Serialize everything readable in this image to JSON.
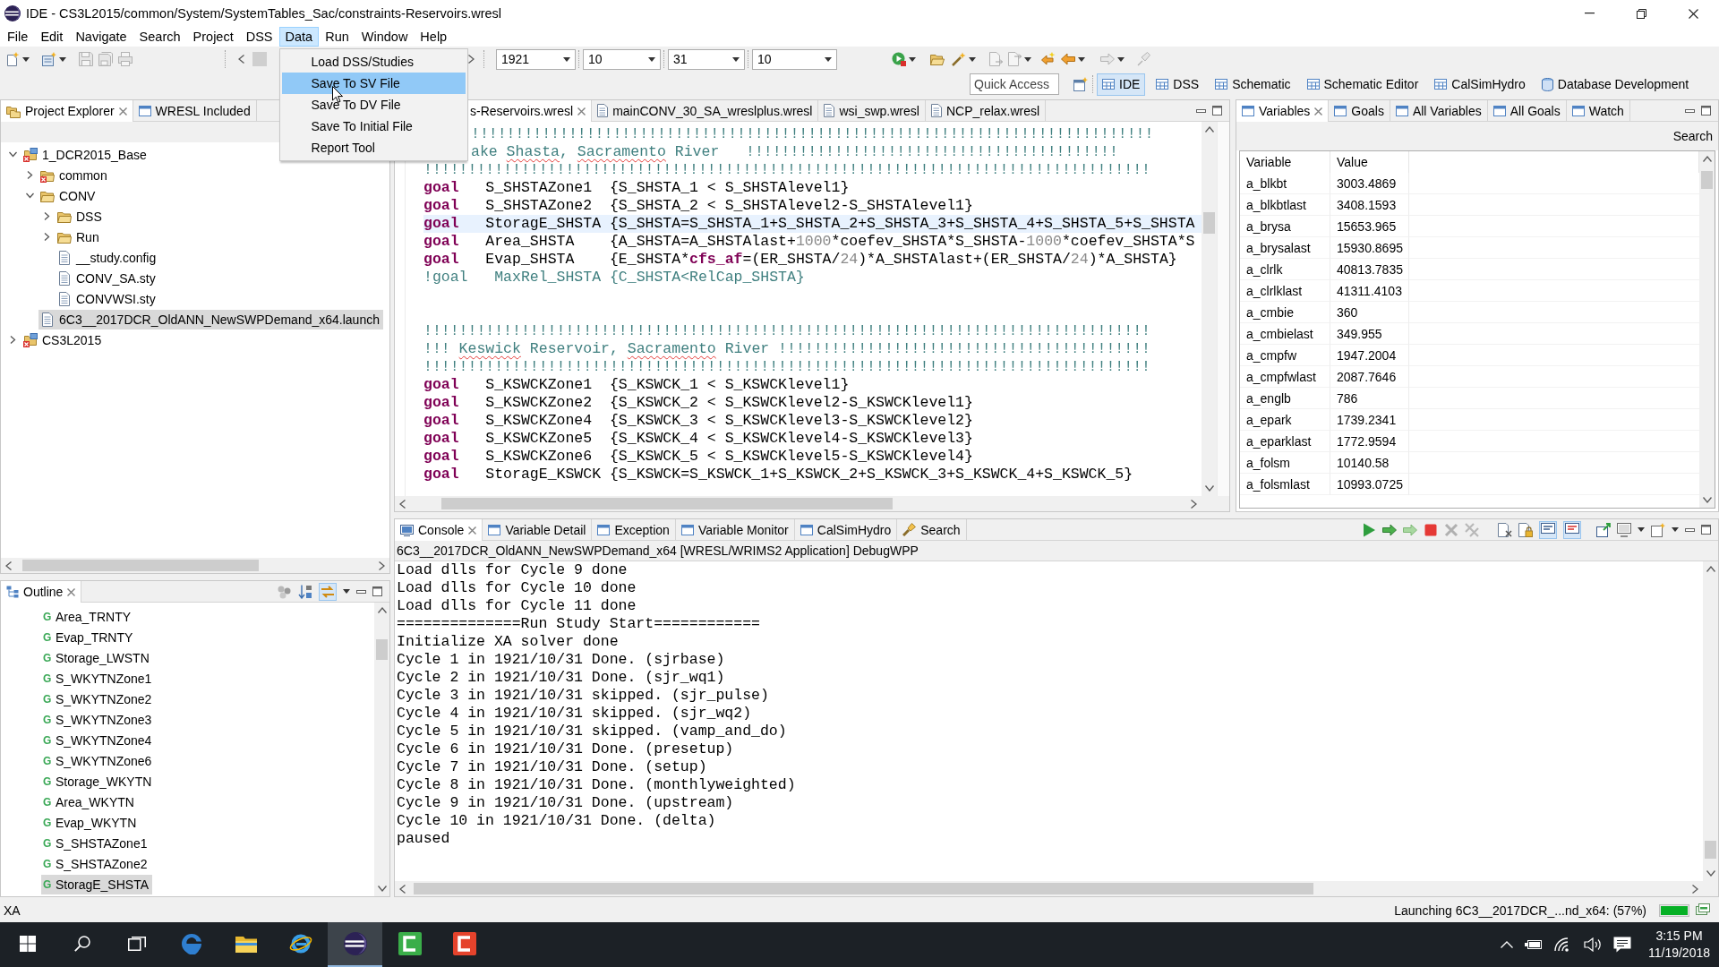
{
  "window": {
    "title": "IDE - CS3L2015/common/System/SystemTables_Sac/constraints-Reservoirs.wresl"
  },
  "menu_bar": [
    {
      "label": "File",
      "selected": false
    },
    {
      "label": "Edit",
      "selected": false
    },
    {
      "label": "Navigate",
      "selected": false
    },
    {
      "label": "Search",
      "selected": false
    },
    {
      "label": "Project",
      "selected": false
    },
    {
      "label": "DSS",
      "selected": false
    },
    {
      "label": "Data",
      "selected": true,
      "items": [
        {
          "label": "Load DSS/Studies",
          "selected": false
        },
        {
          "label": "Save To SV File",
          "selected": true
        },
        {
          "label": "Save To DV File",
          "selected": false
        },
        {
          "label": "Save To Initial File",
          "selected": false
        },
        {
          "label": "Report Tool",
          "selected": false
        }
      ]
    },
    {
      "label": "Run",
      "selected": false
    },
    {
      "label": "Window",
      "selected": false
    },
    {
      "label": "Help",
      "selected": false
    }
  ],
  "toolbar": {
    "combos": [
      {
        "value": "1921"
      },
      {
        "value": "10"
      },
      {
        "value": "31"
      },
      {
        "value": "10"
      }
    ],
    "quick_access": {
      "placeholder": "Quick Access"
    },
    "perspectives": [
      {
        "label": "IDE",
        "selected": true
      },
      {
        "label": "DSS",
        "selected": false
      },
      {
        "label": "Schematic",
        "selected": false
      },
      {
        "label": "Schematic Editor",
        "selected": false
      },
      {
        "label": "CalSimHydro",
        "selected": false
      },
      {
        "label": "Database Development",
        "selected": false
      }
    ]
  },
  "project_explorer": {
    "tabs": [
      {
        "label": "Project Explorer",
        "selected": true
      },
      {
        "label": "WRESL Included",
        "selected": false
      }
    ],
    "tree": [
      {
        "label": "1_DCR2015_Base",
        "kind": "project",
        "error": true,
        "expanded": true,
        "selected": false,
        "children": [
          {
            "label": "common",
            "kind": "folder",
            "error": true,
            "expanded": false,
            "selected": false
          },
          {
            "label": "CONV",
            "kind": "folder",
            "error": false,
            "expanded": true,
            "selected": false,
            "children": [
              {
                "label": "DSS",
                "kind": "folder",
                "error": false,
                "expanded": false,
                "selected": false
              },
              {
                "label": "Run",
                "kind": "folder",
                "error": false,
                "expanded": false,
                "selected": false
              },
              {
                "label": "__study.config",
                "kind": "file",
                "error": false,
                "selected": false
              },
              {
                "label": "CONV_SA.sty",
                "kind": "file",
                "error": false,
                "selected": false
              },
              {
                "label": "CONVWSI.sty",
                "kind": "file",
                "error": false,
                "selected": false
              }
            ]
          },
          {
            "label": "6C3__2017DCR_OldANN_NewSWPDemand_x64.launch",
            "kind": "file",
            "error": false,
            "selected": true
          }
        ]
      },
      {
        "label": "CS3L2015",
        "kind": "project",
        "error": true,
        "expanded": false,
        "selected": false
      }
    ]
  },
  "outline": {
    "tabs": [
      {
        "label": "Outline",
        "selected": true
      }
    ],
    "toolbar_toggle": {
      "on": true
    },
    "items": [
      {
        "type_letter": "G",
        "label": "Area_TRNTY",
        "selected": false
      },
      {
        "type_letter": "G",
        "label": "Evap_TRNTY",
        "selected": false
      },
      {
        "type_letter": "G",
        "label": "Storage_LWSTN",
        "selected": false
      },
      {
        "type_letter": "G",
        "label": "S_WKYTNZone1",
        "selected": false
      },
      {
        "type_letter": "G",
        "label": "S_WKYTNZone2",
        "selected": false
      },
      {
        "type_letter": "G",
        "label": "S_WKYTNZone3",
        "selected": false
      },
      {
        "type_letter": "G",
        "label": "S_WKYTNZone4",
        "selected": false
      },
      {
        "type_letter": "G",
        "label": "S_WKYTNZone6",
        "selected": false
      },
      {
        "type_letter": "G",
        "label": "Storage_WKYTN",
        "selected": false
      },
      {
        "type_letter": "G",
        "label": "Area_WKYTN",
        "selected": false
      },
      {
        "type_letter": "G",
        "label": "Evap_WKYTN",
        "selected": false
      },
      {
        "type_letter": "G",
        "label": "S_SHSTAZone1",
        "selected": false
      },
      {
        "type_letter": "G",
        "label": "S_SHSTAZone2",
        "selected": false
      },
      {
        "type_letter": "G",
        "label": "StoragE_SHSTA",
        "selected": true
      }
    ]
  },
  "editor": {
    "tabs": [
      {
        "label": "s-Reservoirs.wresl",
        "selected": true,
        "partly_hidden": true
      },
      {
        "label": "mainCONV_30_SA_wreslplus.wresl",
        "selected": false
      },
      {
        "label": "wsi_swp.wresl",
        "selected": false
      },
      {
        "label": "NCP_relax.wresl",
        "selected": false
      }
    ],
    "lines": [
      {
        "kind": "code",
        "current": false,
        "partly_hidden": true,
        "tokens": [
          {
            "kind": "comment",
            "text": "!!!!!!!!!!!!!!!!!!!!!!!!!!!!!!!!!!!!!!!!!!!!!!!!!!!!!!!!!!!!!!!!!!!!!!!!!!!!!"
          }
        ]
      },
      {
        "kind": "code",
        "current": false,
        "partly_hidden": true,
        "tokens": [
          {
            "kind": "comment",
            "text": "ake "
          },
          {
            "kind": "misspelled",
            "text": "Shasta"
          },
          {
            "kind": "comment",
            "text": ", "
          },
          {
            "kind": "misspelled",
            "text": "Sacramento"
          },
          {
            "kind": "comment",
            "text": " River   !!!!!!!!!!!!!!!!!!!!!!!!!!!!!!!!!!!!!!!!!!"
          }
        ]
      },
      {
        "kind": "code",
        "current": false,
        "tokens": [
          {
            "kind": "comment",
            "text": "!!!!!!!!!!!!!!!!!!!!!!!!!!!!!!!!!!!!!!!!!!!!!!!!!!!!!!!!!!!!!!!!!!!!!!!!!!!!!!!!!!"
          }
        ]
      },
      {
        "kind": "code",
        "current": false,
        "tokens": [
          {
            "kind": "keyword",
            "text": "goal"
          },
          {
            "kind": "code",
            "text": "   S_SHSTAZone1  {S_SHSTA_1 < S_SHSTAlevel1}"
          }
        ]
      },
      {
        "kind": "code",
        "current": false,
        "tokens": [
          {
            "kind": "keyword",
            "text": "goal"
          },
          {
            "kind": "code",
            "text": "   S_SHSTAZone2  {S_SHSTA_2 < S_SHSTAlevel2-S_SHSTAlevel1}"
          }
        ]
      },
      {
        "kind": "code",
        "current": true,
        "tokens": [
          {
            "kind": "keyword",
            "text": "goal"
          },
          {
            "kind": "code",
            "text": "   StoragE_SHSTA {S_SHSTA=S_SHSTA_1+S_SHSTA_2+S_SHSTA_3+S_SHSTA_4+S_SHSTA_5+S_SHSTA"
          }
        ]
      },
      {
        "kind": "code",
        "current": false,
        "tokens": [
          {
            "kind": "keyword",
            "text": "goal"
          },
          {
            "kind": "code",
            "text": "   Area_SHSTA    {A_SHSTA=A_SHSTAlast+"
          },
          {
            "kind": "number",
            "text": "1000"
          },
          {
            "kind": "code",
            "text": "*coefev_SHSTA*S_SHSTA-"
          },
          {
            "kind": "number",
            "text": "1000"
          },
          {
            "kind": "code",
            "text": "*coefev_SHSTA*S"
          }
        ]
      },
      {
        "kind": "code",
        "current": false,
        "tokens": [
          {
            "kind": "keyword",
            "text": "goal"
          },
          {
            "kind": "code",
            "text": "   Evap_SHSTA    {E_SHSTA*"
          },
          {
            "kind": "keyword",
            "text": "cfs_af"
          },
          {
            "kind": "code",
            "text": "=(ER_SHSTA/"
          },
          {
            "kind": "number",
            "text": "24"
          },
          {
            "kind": "code",
            "text": ")*A_SHSTAlast+(ER_SHSTA/"
          },
          {
            "kind": "number",
            "text": "24"
          },
          {
            "kind": "code",
            "text": ")*A_SHSTA}"
          }
        ]
      },
      {
        "kind": "code",
        "current": false,
        "tokens": [
          {
            "kind": "comment",
            "text": "!goal   MaxRel_SHSTA {C_SHSTA<RelCap_SHSTA}"
          }
        ]
      },
      {
        "kind": "blank"
      },
      {
        "kind": "blank"
      },
      {
        "kind": "code",
        "current": false,
        "tokens": [
          {
            "kind": "comment",
            "text": "!!!!!!!!!!!!!!!!!!!!!!!!!!!!!!!!!!!!!!!!!!!!!!!!!!!!!!!!!!!!!!!!!!!!!!!!!!!!!!!!!!"
          }
        ]
      },
      {
        "kind": "code",
        "current": false,
        "tokens": [
          {
            "kind": "comment",
            "text": "!!! "
          },
          {
            "kind": "misspelled",
            "text": "Keswick"
          },
          {
            "kind": "comment",
            "text": " Reservoir, "
          },
          {
            "kind": "misspelled",
            "text": "Sacramento"
          },
          {
            "kind": "comment",
            "text": " River !!!!!!!!!!!!!!!!!!!!!!!!!!!!!!!!!!!!!!!!!!"
          }
        ]
      },
      {
        "kind": "code",
        "current": false,
        "tokens": [
          {
            "kind": "comment",
            "text": "!!!!!!!!!!!!!!!!!!!!!!!!!!!!!!!!!!!!!!!!!!!!!!!!!!!!!!!!!!!!!!!!!!!!!!!!!!!!!!!!!!"
          }
        ]
      },
      {
        "kind": "code",
        "current": false,
        "tokens": [
          {
            "kind": "keyword",
            "text": "goal"
          },
          {
            "kind": "code",
            "text": "   S_KSWCKZone1  {S_KSWCK_1 < S_KSWCKlevel1}"
          }
        ]
      },
      {
        "kind": "code",
        "current": false,
        "tokens": [
          {
            "kind": "keyword",
            "text": "goal"
          },
          {
            "kind": "code",
            "text": "   S_KSWCKZone2  {S_KSWCK_2 < S_KSWCKlevel2-S_KSWCKlevel1}"
          }
        ]
      },
      {
        "kind": "code",
        "current": false,
        "tokens": [
          {
            "kind": "keyword",
            "text": "goal"
          },
          {
            "kind": "code",
            "text": "   S_KSWCKZone4  {S_KSWCK_3 < S_KSWCKlevel3-S_KSWCKlevel2}"
          }
        ]
      },
      {
        "kind": "code",
        "current": false,
        "tokens": [
          {
            "kind": "keyword",
            "text": "goal"
          },
          {
            "kind": "code",
            "text": "   S_KSWCKZone5  {S_KSWCK_4 < S_KSWCKlevel4-S_KSWCKlevel3}"
          }
        ]
      },
      {
        "kind": "code",
        "current": false,
        "tokens": [
          {
            "kind": "keyword",
            "text": "goal"
          },
          {
            "kind": "code",
            "text": "   S_KSWCKZone6  {S_KSWCK_5 < S_KSWCKlevel5-S_KSWCKlevel4}"
          }
        ]
      },
      {
        "kind": "code",
        "current": false,
        "tokens": [
          {
            "kind": "keyword",
            "text": "goal"
          },
          {
            "kind": "code",
            "text": "   StoragE_KSWCK {S_KSWCK=S_KSWCK_1+S_KSWCK_2+S_KSWCK_3+S_KSWCK_4+S_KSWCK_5}"
          }
        ]
      }
    ]
  },
  "variables_view": {
    "tabs": [
      {
        "label": "Variables",
        "selected": true
      },
      {
        "label": "Goals",
        "selected": false
      },
      {
        "label": "All Variables",
        "selected": false
      },
      {
        "label": "All Goals",
        "selected": false
      },
      {
        "label": "Watch",
        "selected": false
      }
    ],
    "search": "Search",
    "columns": [
      "Variable",
      "Value"
    ],
    "rows": [
      {
        "variable": "a_blkbt",
        "value": "3003.4869"
      },
      {
        "variable": "a_blkbtlast",
        "value": "3408.1593"
      },
      {
        "variable": "a_brysa",
        "value": "15653.965"
      },
      {
        "variable": "a_brysalast",
        "value": "15930.8695"
      },
      {
        "variable": "a_clrlk",
        "value": "40813.7835"
      },
      {
        "variable": "a_clrlklast",
        "value": "41311.4103"
      },
      {
        "variable": "a_cmbie",
        "value": "360"
      },
      {
        "variable": "a_cmbielast",
        "value": "349.955"
      },
      {
        "variable": "a_cmpfw",
        "value": "1947.2004"
      },
      {
        "variable": "a_cmpfwlast",
        "value": "2087.7646"
      },
      {
        "variable": "a_englb",
        "value": "786"
      },
      {
        "variable": "a_epark",
        "value": "1739.2341"
      },
      {
        "variable": "a_eparklast",
        "value": "1772.9594"
      },
      {
        "variable": "a_folsm",
        "value": "10140.58"
      },
      {
        "variable": "a_folsmlast",
        "value": "10993.0725"
      }
    ]
  },
  "console": {
    "tabs": [
      {
        "label": "Console",
        "selected": true
      },
      {
        "label": "Variable Detail",
        "selected": false
      },
      {
        "label": "Exception",
        "selected": false
      },
      {
        "label": "Variable Monitor",
        "selected": false
      },
      {
        "label": "CalSimHydro",
        "selected": false
      },
      {
        "label": "Search",
        "selected": false
      }
    ],
    "toolbar_toggles": [
      {
        "on": true
      },
      {
        "on": true
      }
    ],
    "process": "6C3__2017DCR_OldANN_NewSWPDemand_x64 [WRESL/WRIMS2 Application] DebugWPP",
    "lines": [
      "Load dlls for Cycle 9 done",
      "Load dlls for Cycle 10 done",
      "Load dlls for Cycle 11 done",
      "==============Run Study Start============",
      "Initialize XA solver done",
      "Cycle 1 in 1921/10/31 Done. (sjrbase)",
      "Cycle 2 in 1921/10/31 Done. (sjr_wq1)",
      "Cycle 3 in 1921/10/31 skipped. (sjr_pulse)",
      "Cycle 4 in 1921/10/31 skipped. (sjr_wq2)",
      "Cycle 5 in 1921/10/31 skipped. (vamp_and_do)",
      "Cycle 6 in 1921/10/31 Done. (presetup)",
      "Cycle 7 in 1921/10/31 Done. (setup)",
      "Cycle 8 in 1921/10/31 Done. (monthlyweighted)",
      "Cycle 9 in 1921/10/31 Done. (upstream)",
      "Cycle 10 in 1921/10/31 Done. (delta)",
      "paused"
    ]
  },
  "status_bar": {
    "message": "XA",
    "progress_text": "Launching 6C3__2017DCR_...nd_x64: (57%)",
    "progress": {
      "level": 1
    }
  },
  "taskbar": {
    "buttons": [
      {
        "kind": "start",
        "active": false
      },
      {
        "kind": "search",
        "active": false
      },
      {
        "kind": "task-view",
        "active": false
      },
      {
        "kind": "edge",
        "active": false
      },
      {
        "kind": "file-explorer",
        "active": false
      },
      {
        "kind": "internet-explorer",
        "active": false
      },
      {
        "kind": "eclipse",
        "active": true
      },
      {
        "kind": "tile",
        "color": "#3aae49",
        "active": false
      },
      {
        "kind": "tile",
        "color": "#e5432c",
        "active": false
      }
    ],
    "clock": {
      "time": "3:15 PM",
      "date": "11/19/2018"
    }
  }
}
